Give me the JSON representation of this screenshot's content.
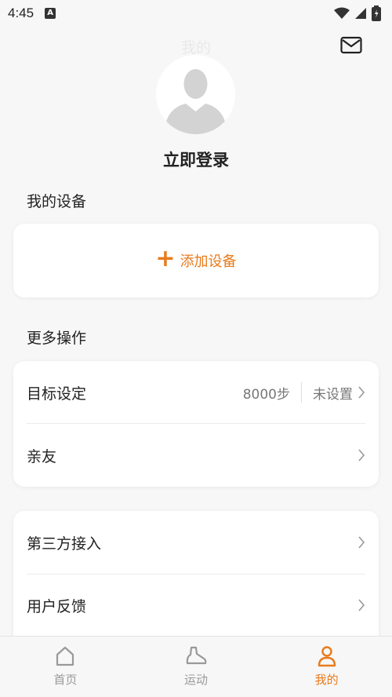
{
  "status_bar": {
    "time": "4:45",
    "notification_glyph": "A",
    "icons": [
      "wifi-icon",
      "signal-icon",
      "battery-icon"
    ]
  },
  "header": {
    "title": "我的",
    "mail_icon": "mail-icon"
  },
  "profile": {
    "login_label": "立即登录"
  },
  "devices": {
    "section_title": "我的设备",
    "add_label": "添加设备"
  },
  "more": {
    "section_title": "更多操作",
    "items": [
      {
        "label": "目标设定",
        "value": "8000步",
        "status": "未设置"
      },
      {
        "label": "亲友"
      }
    ]
  },
  "extra": {
    "items": [
      {
        "label": "第三方接入"
      },
      {
        "label": "用户反馈"
      }
    ]
  },
  "bottom_nav": {
    "items": [
      {
        "label": "首页",
        "icon": "home-icon"
      },
      {
        "label": "运动",
        "icon": "shoe-icon"
      },
      {
        "label": "我的",
        "icon": "person-icon",
        "active": true
      }
    ]
  },
  "colors": {
    "accent": "#e87b1c",
    "background": "#f7f7f7",
    "card": "#ffffff"
  }
}
